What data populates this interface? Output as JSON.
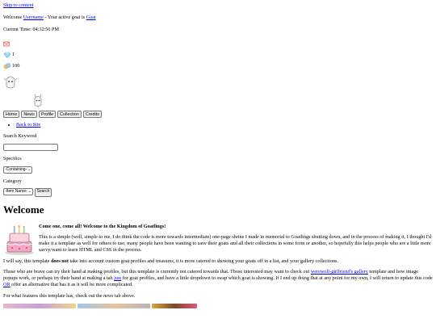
{
  "skip_link": "Skip to content",
  "welcome_bar": {
    "prefix": "Welcome ",
    "username": "Username",
    "middle": " - Your active goat is ",
    "goat": "Goat"
  },
  "time": {
    "label": "Current Time: ",
    "value": "04:32:56 PM"
  },
  "stats": {
    "gems": "1",
    "coins": "100"
  },
  "nav": [
    "Home",
    "News",
    "Profile",
    "Collection",
    "Credits"
  ],
  "back_link": "Back to Site",
  "search": {
    "keyword_label": "Search Keyword",
    "keyword_value": "",
    "specifics_label": "Specifics",
    "specifics_selected": "-Containing-",
    "category_label": "Category",
    "category_selected": "-Item Name-",
    "search_button": "Search"
  },
  "content": {
    "heading": "Welcome",
    "intro_bold": "Come one, come all! Welcome to the Kingdom of Goatlings!",
    "p1": "This is a simple (well, simple to me, I do think the code is more towards intermediate) one-page shrine I made in memorial to Goatlings shutting down, and in the process of making it, I thought I'd make it a template as well for others to use; many people have been wanting to save their goats and all their collections in some form or another, so hopefully this helps people who are a little more savvy/want to learn HTML and CSS in the process.",
    "p2_a": "I will say, this template ",
    "p2_bold": "does not",
    "p2_b": " take into account custom goat profiles and treasures, it is more catered to showing your goats off in a list, and your gallery collections.",
    "p3_a": "Those who are brave can try their hand at making profiles, but this template is currently not catered towards that. Those interested may want to check out ",
    "p3_link": "werewolf-girlfriend's gallery",
    "p3_b": " template and how image popups work, or perhaps try their hand at making a tab ",
    "p3_link2": "just",
    "p3_c": " for goat profiles, and have a little dropdown to swap which goat is showing. If I end up doing that at any point for my own, I will return to update this code ",
    "p3_link3": "OR",
    "p3_d": " offer an alternative that has it as it will be more complicated.",
    "p4_a": "For what features this template has, check out the ",
    "p4_em": "news",
    "p4_b": " tab above."
  },
  "colors": {
    "link": "#0000ee",
    "mail_icon": "#e06b6b",
    "gem_icon": "#4fb3e0",
    "coin_icon": "#d9a53a",
    "cake_pink": "#f3a7c7",
    "cake_brown": "#7a4a2e"
  }
}
